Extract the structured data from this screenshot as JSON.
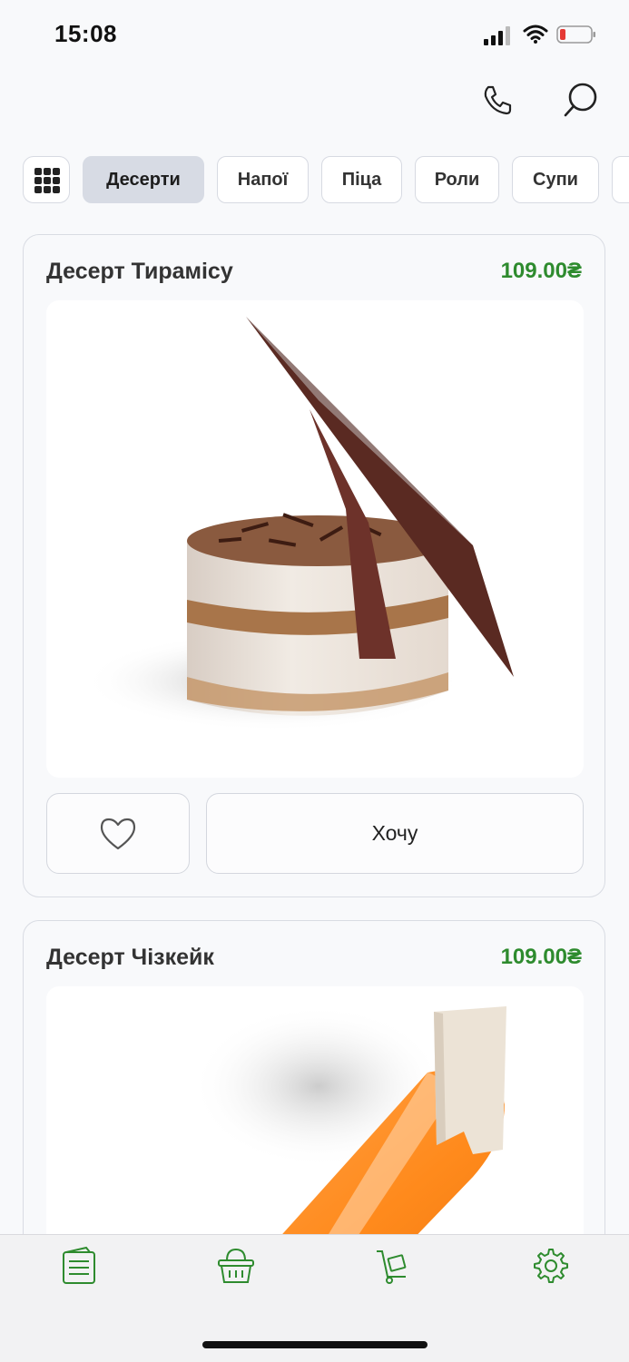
{
  "status_bar": {
    "time": "15:08"
  },
  "categories": {
    "items": [
      "Десерти",
      "Напої",
      "Піца",
      "Роли",
      "Супи"
    ],
    "active": "Десерти"
  },
  "products": [
    {
      "name": "Десерт Тирамісу",
      "price": "109.00₴",
      "want_label": "Хочу"
    },
    {
      "name": "Десерт Чізкейк",
      "price": "109.00₴"
    }
  ],
  "colors": {
    "price": "#2e8b2e",
    "accent": "#2e8b2e",
    "active_chip": "#d7dbe4"
  },
  "icons": {
    "header": [
      "phone-icon",
      "search-icon"
    ],
    "bottom_nav": [
      "menu-list-icon",
      "basket-icon",
      "delivery-cart-icon",
      "settings-gear-icon"
    ]
  }
}
